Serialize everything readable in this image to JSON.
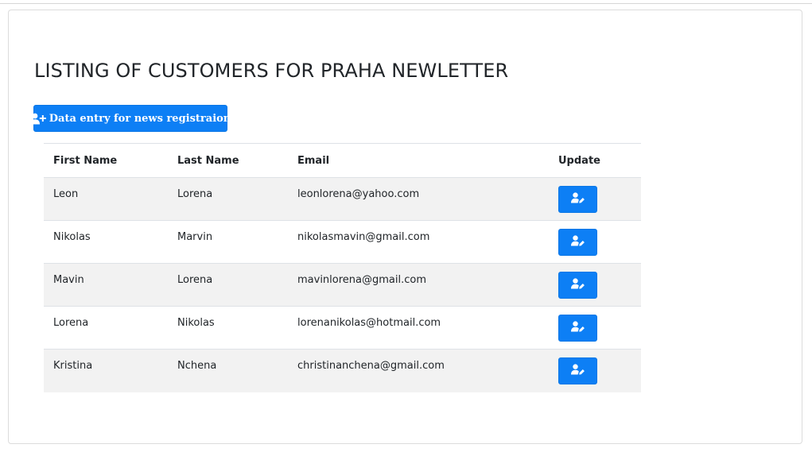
{
  "page": {
    "title": "LISTING OF CUSTOMERS FOR PRAHA NEWLETTER"
  },
  "toolbar": {
    "add_button_label": "Data entry for news registraion",
    "add_button_icon": "user-plus-icon"
  },
  "table": {
    "headers": {
      "first_name": "First Name",
      "last_name": "Last Name",
      "email": "Email",
      "update": "Update"
    },
    "update_icon": "user-edit-icon",
    "rows": [
      {
        "first_name": "Leon",
        "last_name": "Lorena",
        "email": "leonlorena@yahoo.com"
      },
      {
        "first_name": "Nikolas",
        "last_name": "Marvin",
        "email": "nikolasmavin@gmail.com"
      },
      {
        "first_name": "Mavin",
        "last_name": "Lorena",
        "email": "mavinlorena@gmail.com"
      },
      {
        "first_name": "Lorena",
        "last_name": "Nikolas",
        "email": "lorenanikolas@hotmail.com"
      },
      {
        "first_name": "Kristina",
        "last_name": "Nchena",
        "email": "christinanchena@gmail.com"
      }
    ]
  },
  "colors": {
    "primary": "#0d7ff5",
    "stripe": "#f2f2f2",
    "text": "#212529",
    "border": "#dee2e6"
  }
}
